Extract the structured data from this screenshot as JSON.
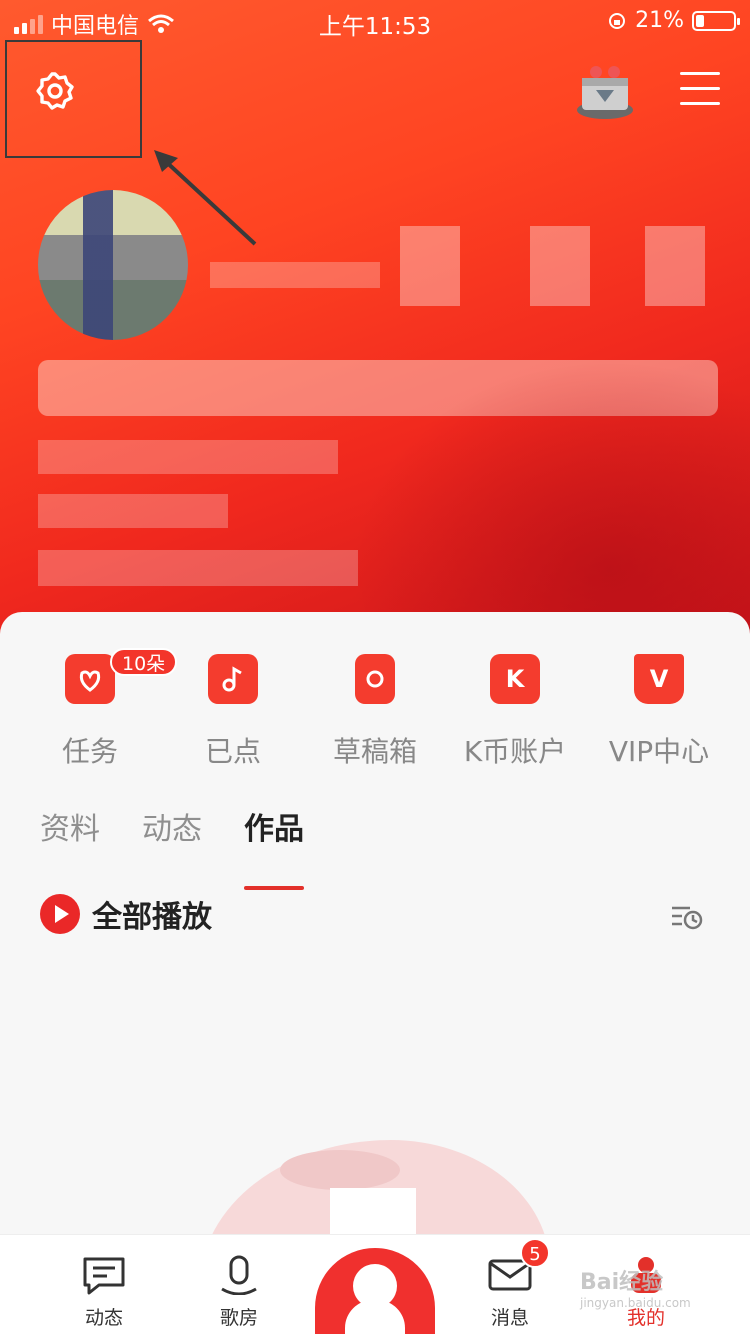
{
  "status_bar": {
    "carrier": "中国电信",
    "time": "上午11:53",
    "battery_percent": "21%"
  },
  "quick_actions": [
    {
      "label": "任务",
      "icon": "task-flower-icon",
      "badge": "10朵"
    },
    {
      "label": "已点",
      "icon": "music-note-icon"
    },
    {
      "label": "草稿箱",
      "icon": "draft-record-icon"
    },
    {
      "label": "K币账户",
      "icon": "k-coin-icon",
      "glyph": "K"
    },
    {
      "label": "VIP中心",
      "icon": "vip-crown-icon",
      "glyph": "V"
    }
  ],
  "tabs": [
    {
      "label": "资料",
      "active": false
    },
    {
      "label": "动态",
      "active": false
    },
    {
      "label": "作品",
      "active": true
    }
  ],
  "play_all": {
    "label": "全部播放"
  },
  "bottom_nav": [
    {
      "label": "动态",
      "icon": "feed-chat-icon",
      "active": false
    },
    {
      "label": "歌房",
      "icon": "microphone-icon",
      "active": false
    },
    {
      "label": "",
      "icon": "sing-center-icon",
      "active": false
    },
    {
      "label": "消息",
      "icon": "envelope-icon",
      "active": false,
      "badge": "5"
    },
    {
      "label": "我的",
      "icon": "profile-icon",
      "active": true
    }
  ],
  "watermark": {
    "text": "Bai经验",
    "sub": "jingyan.baidu.com"
  },
  "colors": {
    "accent": "#e3302a",
    "hero": "#ff4422",
    "card": "#f7f7f7"
  }
}
